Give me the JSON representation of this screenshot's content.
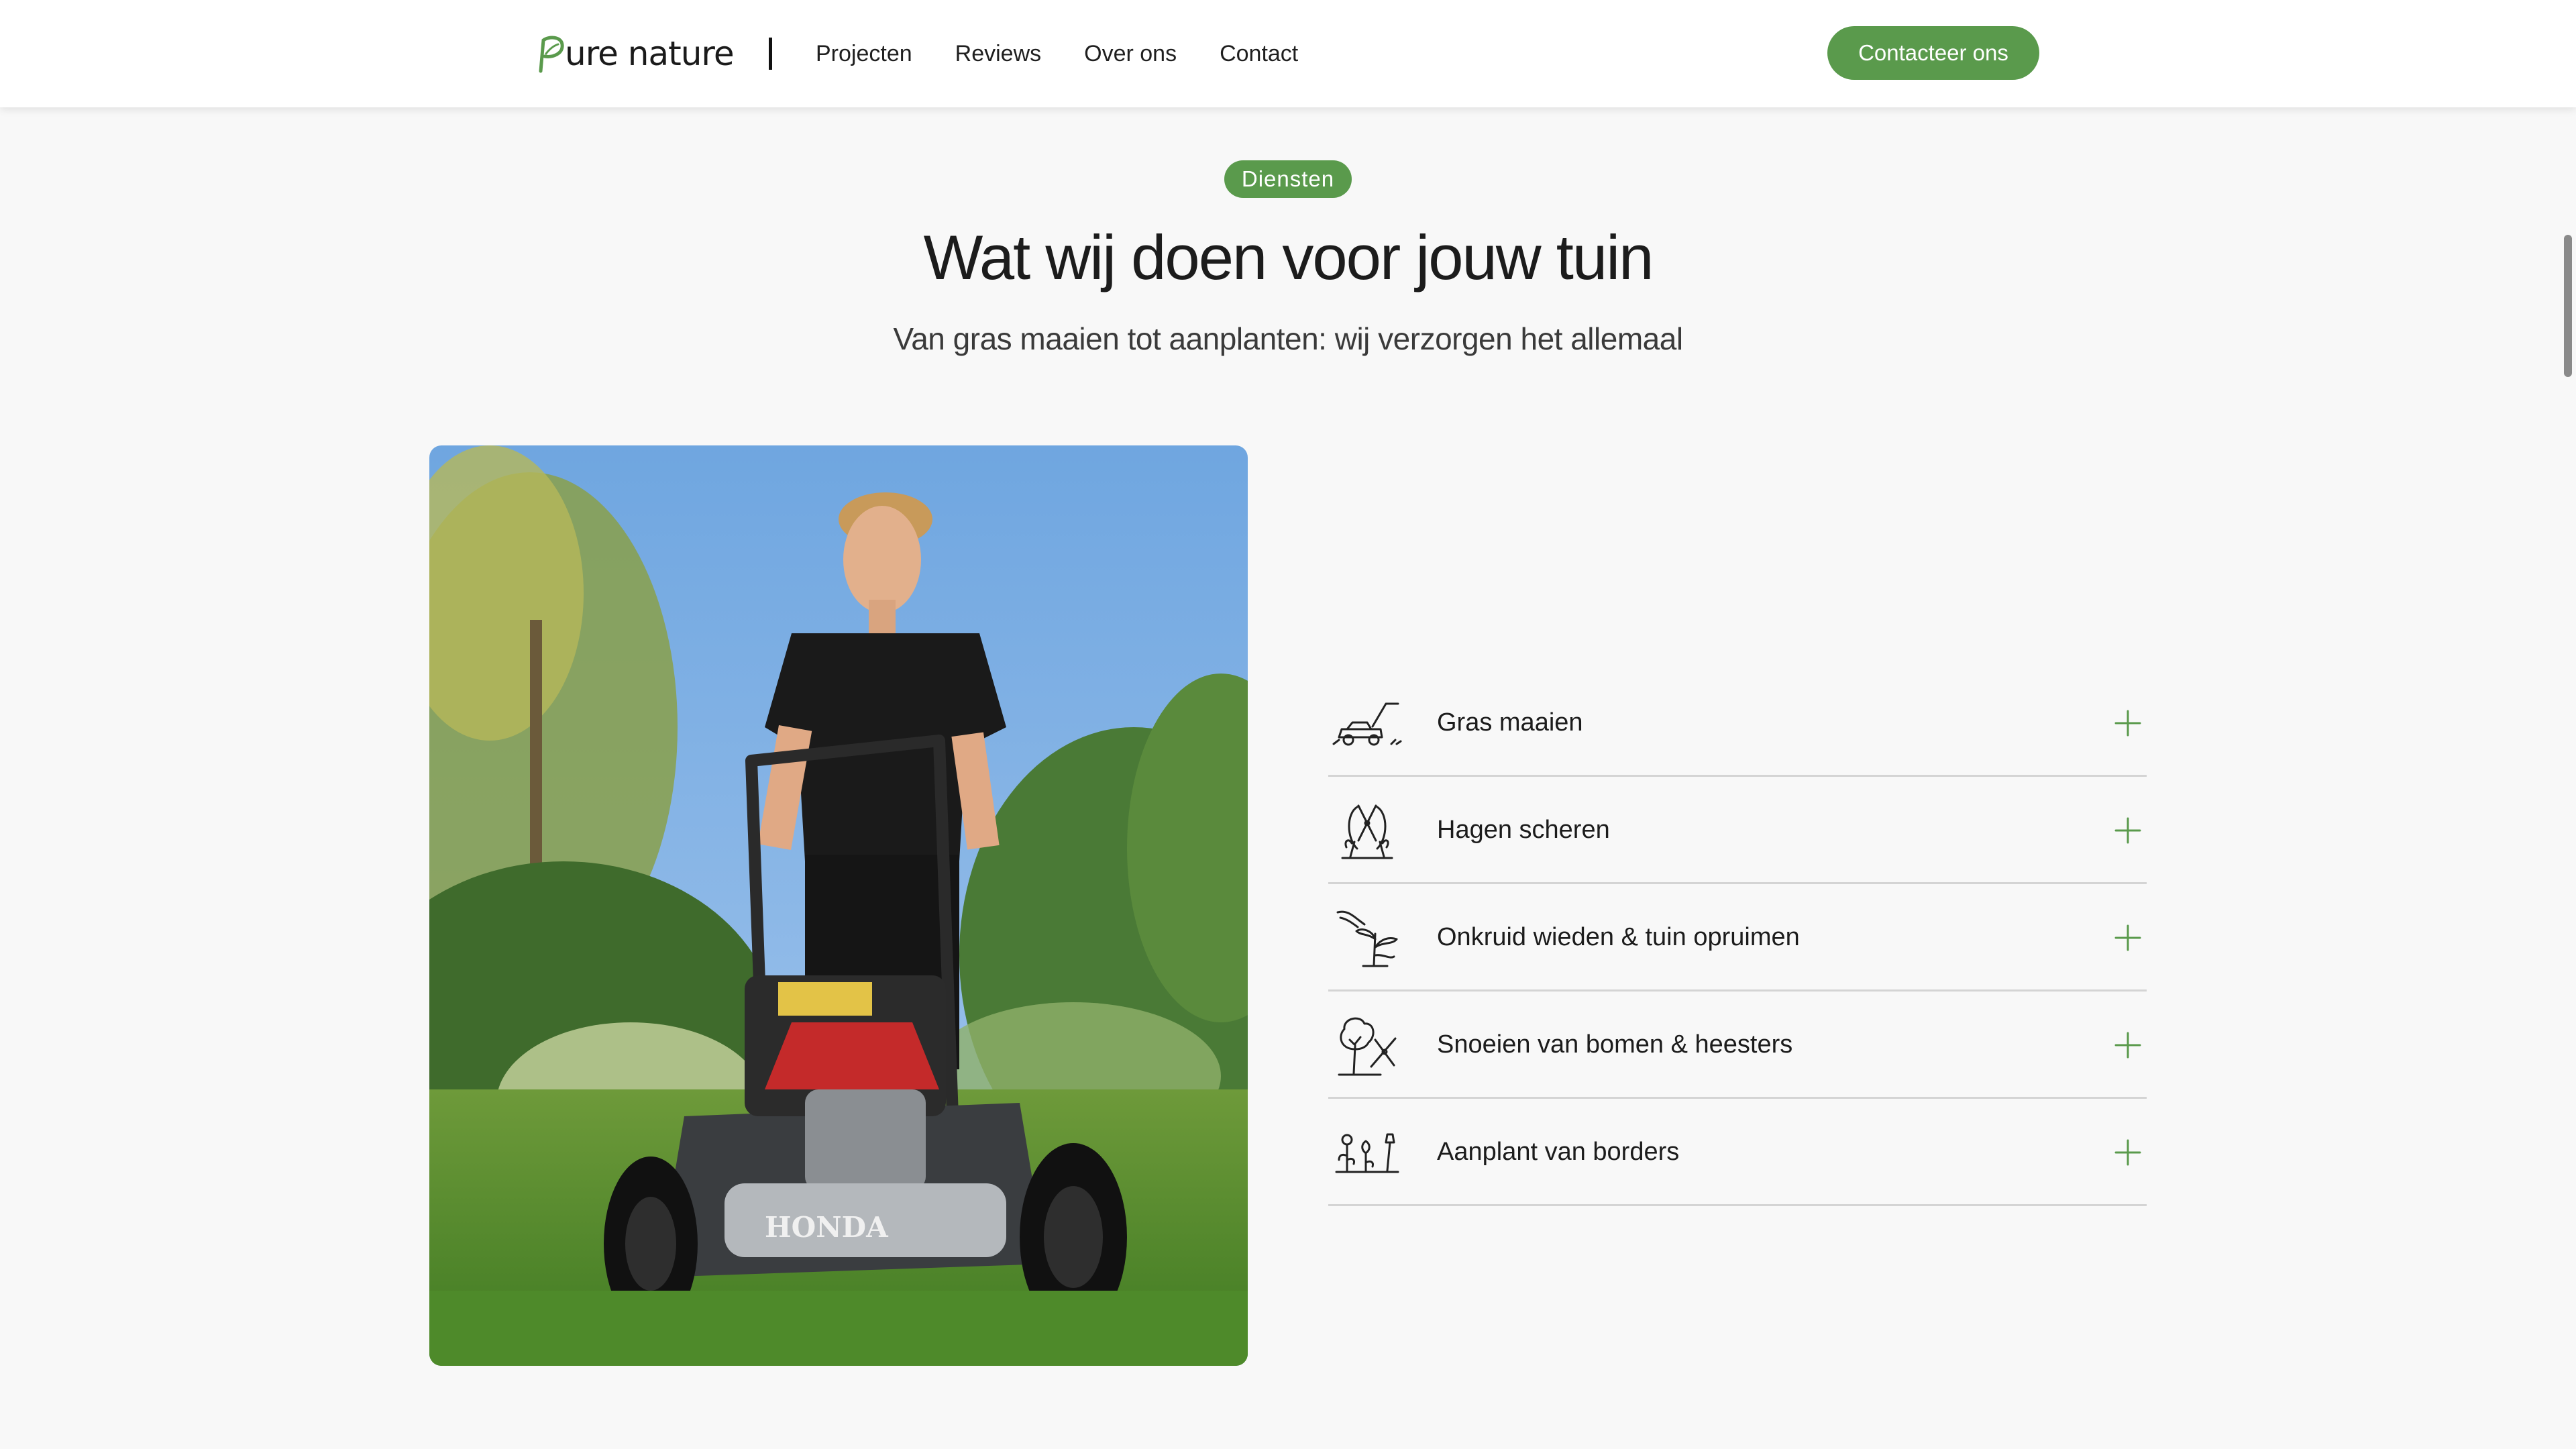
{
  "brand": {
    "name": "ure nature",
    "accent": "#5a9a4c"
  },
  "nav": {
    "items": [
      {
        "label": "Projecten"
      },
      {
        "label": "Reviews"
      },
      {
        "label": "Over ons"
      },
      {
        "label": "Contact"
      }
    ],
    "cta_label": "Contacteer ons"
  },
  "section": {
    "badge": "Diensten",
    "title": "Wat wij doen voor jouw tuin",
    "subtitle": "Van gras maaien tot aanplanten: wij verzorgen het allemaal"
  },
  "services": [
    {
      "label": "Gras maaien",
      "icon": "lawn-mower-icon"
    },
    {
      "label": "Hagen scheren",
      "icon": "hedge-shears-icon"
    },
    {
      "label": "Onkruid wieden & tuin opruimen",
      "icon": "weeding-icon"
    },
    {
      "label": "Snoeien van bomen & heesters",
      "icon": "tree-pruning-icon"
    },
    {
      "label": "Aanplant van borders",
      "icon": "planting-icon"
    }
  ]
}
